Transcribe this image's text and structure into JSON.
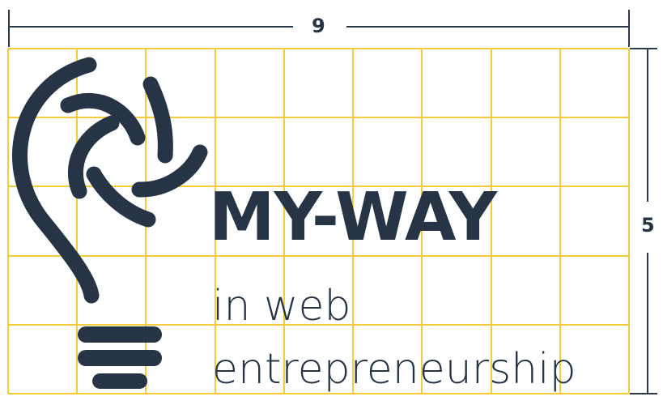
{
  "dimensions": {
    "width_label": "9",
    "height_label": "5"
  },
  "grid": {
    "columns": 9,
    "rows": 5,
    "line_color": "#f2cc3a"
  },
  "logo": {
    "icon": "lightbulb-icon",
    "color": "#263445",
    "title": "MY-WAY",
    "subtitle_line1": "in web",
    "subtitle_line2": "entrepreneurship"
  }
}
